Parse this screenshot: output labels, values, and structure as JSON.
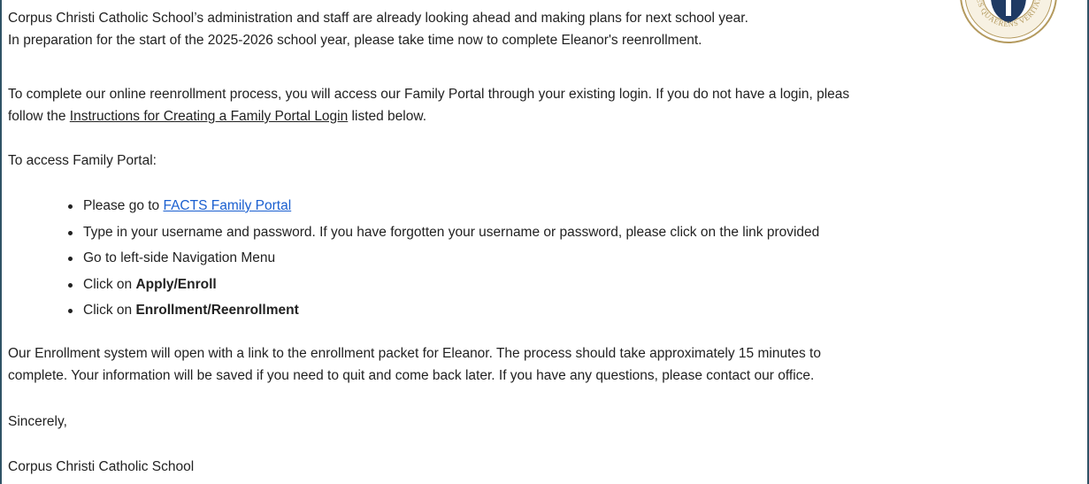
{
  "email": {
    "intro_line1": "Corpus Christi Catholic School’s administration and staff are already looking ahead and making plans for next school year.",
    "intro_line2": "In preparation for the start of the 2025-2026 school year, please take time now to complete Eleanor's reenrollment.",
    "process_line1": "To complete our online reenrollment process, you will access our Family Portal through your existing login. If you do not have a login, pleas",
    "process_prefix": "follow the ",
    "process_link": "Instructions for Creating a Family Portal Login",
    "process_suffix": " listed below.",
    "access_heading": "To access Family Portal:",
    "steps": [
      {
        "prefix": "Please go to ",
        "link": "FACTS Family Portal"
      },
      {
        "text": "Type in your username and password. If you have forgotten your username or password, please click on the link provided"
      },
      {
        "text": "Go to left-side Navigation Menu"
      },
      {
        "prefix": "Click on ",
        "bold": "Apply/Enroll"
      },
      {
        "prefix": "Click on ",
        "bold": "Enrollment/Reenrollment"
      }
    ],
    "result_line1": "Our Enrollment system will open with a link to the enrollment packet for Eleanor. The process should take approximately 15 minutes to",
    "result_line2": "complete. Your information will be saved if you need to quit and come back later. If you have any questions, please contact our office.",
    "closing": "Sincerely,",
    "signature": "Corpus Christi Catholic School",
    "seal_motto": "FIDES QUAERENS VERITATEM"
  },
  "colors": {
    "frame_border": "#2f5366",
    "link": "#1a5fd0",
    "text": "#222222",
    "seal_gold": "#b49a5e",
    "seal_navy": "#1f3a63"
  },
  "icons": {
    "seal": "school-seal-icon"
  }
}
